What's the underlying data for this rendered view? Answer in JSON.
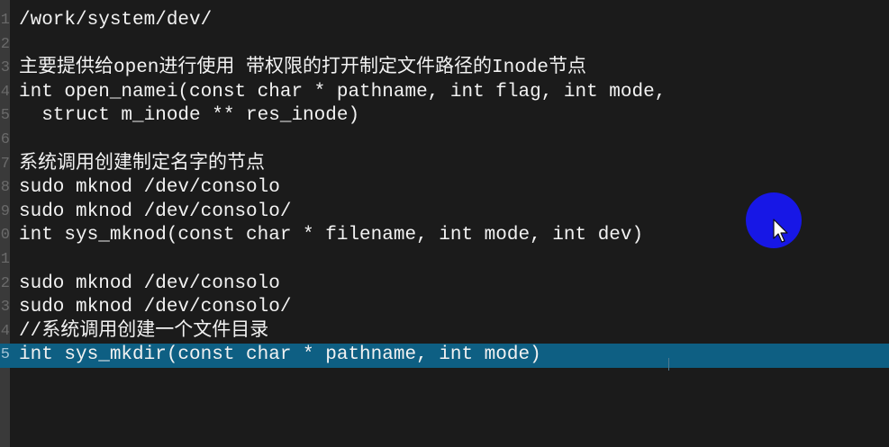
{
  "editor": {
    "lines": [
      {
        "num": "1",
        "text": "/work/system/dev/"
      },
      {
        "num": "2",
        "text": ""
      },
      {
        "num": "3",
        "text": "主要提供给open进行使用 带权限的打开制定文件路径的Inode节点"
      },
      {
        "num": "4",
        "text": "int open_namei(const char * pathname, int flag, int mode,"
      },
      {
        "num": "5",
        "text": "  struct m_inode ** res_inode)"
      },
      {
        "num": "6",
        "text": ""
      },
      {
        "num": "7",
        "text": "系统调用创建制定名字的节点"
      },
      {
        "num": "8",
        "text": "sudo mknod /dev/consolo"
      },
      {
        "num": "9",
        "text": "sudo mknod /dev/consolo/"
      },
      {
        "num": "0",
        "text": "int sys_mknod(const char * filename, int mode, int dev)"
      },
      {
        "num": "1",
        "text": ""
      },
      {
        "num": "2",
        "text": "sudo mknod /dev/consolo"
      },
      {
        "num": "3",
        "text": "sudo mknod /dev/consolo/"
      },
      {
        "num": "4",
        "text": "//系统调用创建一个文件目录"
      },
      {
        "num": "5",
        "text": "int sys_mkdir(const char * pathname, int mode)"
      }
    ]
  },
  "colors": {
    "background": "#1b1b1b",
    "gutter": "#3a3a3a",
    "text": "#f2f2f2",
    "current_line": "#0e5f83",
    "pointer": "#1717e6"
  },
  "icons": {
    "pointer": "mouse-pointer-icon"
  }
}
